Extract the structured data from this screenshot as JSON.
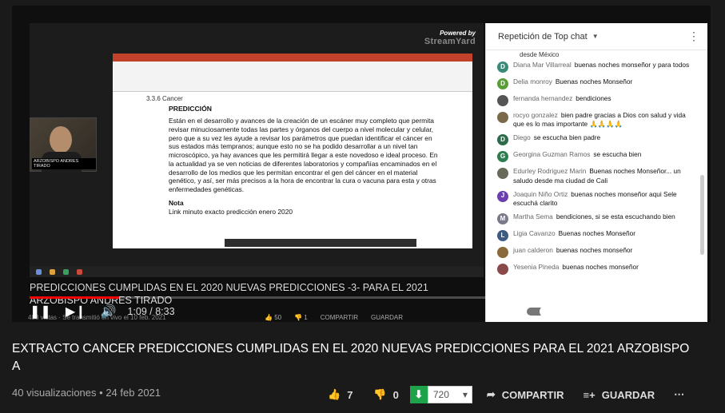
{
  "player": {
    "overlay_title": "PREDICCIONES CUMPLIDAS EN EL 2020 NUEVAS PREDICCIONES -3- PARA EL 2021 ARZOBISPO ANDRES TIRADO",
    "overlay_views": "488 vistas · Se transmitió en vivo el 10 feb. 2021",
    "overlay_likes": "50",
    "overlay_dislikes": "1",
    "overlay_share": "COMPARTIR",
    "overlay_save": "GUARDAR",
    "time_current": "1:09",
    "time_total": "8:33",
    "time_separator": " / ",
    "progress_fraction": 0.135,
    "powered_by": "Powered by",
    "streamyard": "StreamYard",
    "webcam_label": "ARZOBISPO ANDRES TIRADO"
  },
  "document": {
    "section": "3.3.6 Cancer",
    "heading": "PREDICCIÓN",
    "body": "Están en el desarrollo y avances de la creación de un escáner muy completo que permita revisar minuciosamente todas las partes y órganos del cuerpo a nivel molecular y celular, pero que a su vez les ayude a revisar los parámetros que puedan identificar el cáncer en sus estados más tempranos; aunque esto no se ha podido desarrollar a un nivel tan microscópico, ya hay avances que les permitirá llegar a este novedoso e ideal proceso. En la actualidad ya se ven noticias de diferentes laboratorios y compañías encaminados en el desarrollo de los medios que les permitan encontrar el gen del cáncer en el material genético, y así, ser más precisos a la hora de encontrar la cura o vacuna para esta y otras enfermedades genéticas.",
    "note_heading": "Nota",
    "note_text": "Link minuto exacto predicción enero 2020"
  },
  "chat": {
    "title": "Repetición de Top chat",
    "partial_top": "desde México",
    "messages": [
      {
        "initial": "D",
        "color": "#3a8a7a",
        "author": "Diana Mar Villarreal",
        "text": "buenas noches monseñor y para todos"
      },
      {
        "initial": "D",
        "color": "#5a9e3a",
        "author": "Delia monroy",
        "text": "Buenas noches Monseñor"
      },
      {
        "initial": "",
        "color": "#555555",
        "author": "fernanda hernandez",
        "text": "bendiciones"
      },
      {
        "initial": "",
        "color": "#7a6a4a",
        "author": "rocyo gonzalez",
        "text": "bien padre gracias a Dios con salud y vida que es lo mas importante 🙏🙏🙏🙏"
      },
      {
        "initial": "D",
        "color": "#2e6b4a",
        "author": "Diego",
        "text": "se escucha bien padre"
      },
      {
        "initial": "G",
        "color": "#2e7d52",
        "author": "Georgina Guzman Ramos",
        "text": "se escucha bien"
      },
      {
        "initial": "",
        "color": "#6a6a5a",
        "author": "Edurley Rodriguez Marin",
        "text": "Buenas noches Monseñor... un saludo desde ma ciudad de Cali"
      },
      {
        "initial": "J",
        "color": "#6b3fb0",
        "author": "Joaquin Niño Ortiz",
        "text": "buenas noches monseñor aqui Sele escuchá clarito"
      },
      {
        "initial": "M",
        "color": "#7a7a8a",
        "author": "Martha Sema",
        "text": "bendiciones, si se esta escuchando bien"
      },
      {
        "initial": "L",
        "color": "#3d5a80",
        "author": "Ligia Cavanzo",
        "text": "Buenas noches Monseñor"
      },
      {
        "initial": "",
        "color": "#8a6a3a",
        "author": "juan calderon",
        "text": "buenas noches monseñor"
      },
      {
        "initial": "",
        "color": "#8a4a4a",
        "author": "Yesenia Pineda",
        "text": "buenas noches monseñor"
      }
    ]
  },
  "video": {
    "title": "EXTRACTO CANCER PREDICCIONES CUMPLIDAS EN EL 2020 NUEVAS PREDICCIONES PARA EL 2021 ARZOBISPO A",
    "views": "40 visualizaciones",
    "separator": "•",
    "date": "24 feb 2021",
    "likes": "7",
    "dislikes": "0",
    "quality": "720",
    "share_label": "COMPARTIR",
    "save_label": "GUARDAR"
  },
  "colors": {
    "progress": "#ff0000",
    "download_green": "#1fa34a"
  }
}
